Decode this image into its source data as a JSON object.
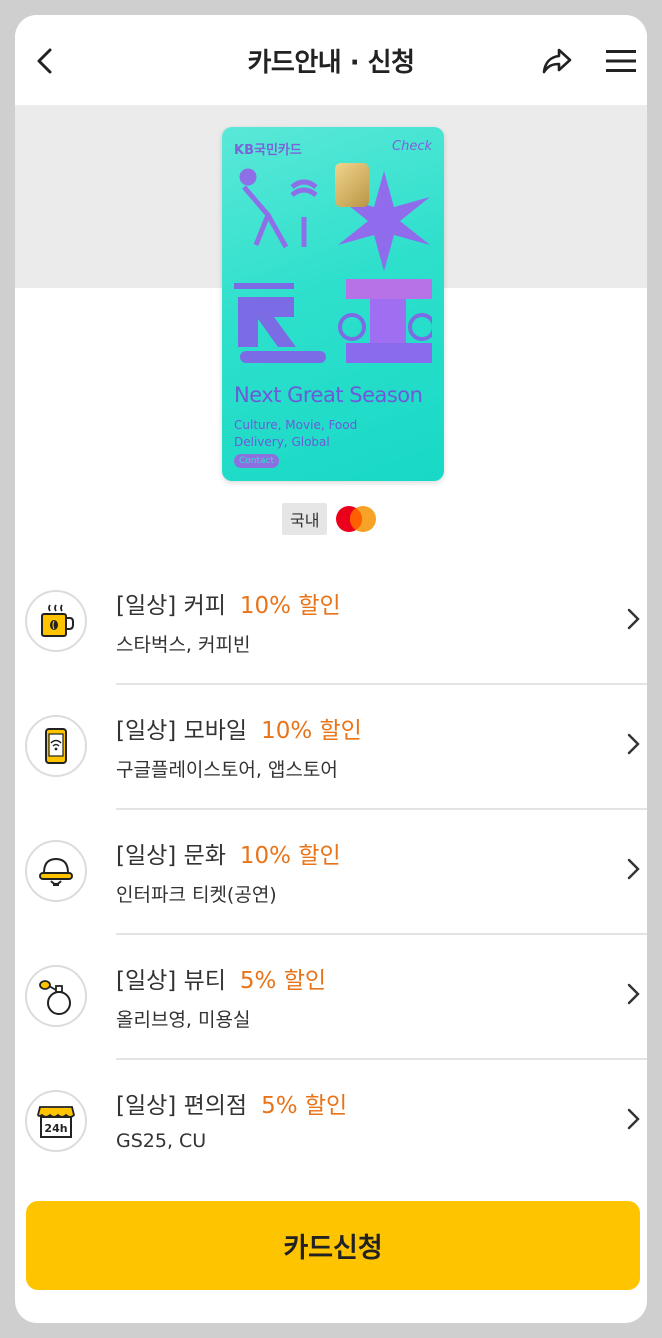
{
  "header": {
    "title": "카드안내 · 신청",
    "back_icon": "chevron-left-icon",
    "share_icon": "share-icon",
    "menu_icon": "hamburger-menu-icon"
  },
  "card": {
    "brand": "KB국민카드",
    "type": "Check",
    "slogan": "Next Great Season",
    "desc_line1": "Culture, Movie, Food",
    "desc_line2": "Delivery, Global",
    "tag": "Contact"
  },
  "badges": {
    "domestic": "국내",
    "network_icon": "mastercard-logo"
  },
  "benefits": [
    {
      "category": "[일상] 커피",
      "discount": "10% 할인",
      "detail": "스타벅스, 커피빈",
      "icon": "coffee-cup-icon"
    },
    {
      "category": "[일상] 모바일",
      "discount": "10% 할인",
      "detail": "구글플레이스토어, 앱스토어",
      "icon": "smartphone-icon"
    },
    {
      "category": "[일상] 문화",
      "discount": "10% 할인",
      "detail": "인터파크 티켓(공연)",
      "icon": "theater-icon"
    },
    {
      "category": "[일상] 뷰티",
      "discount": "5% 할인",
      "detail": "올리브영, 미용실",
      "icon": "perfume-icon"
    },
    {
      "category": "[일상] 편의점",
      "discount": "5% 할인",
      "detail": "GS25, CU",
      "icon": "store-24h-icon"
    }
  ],
  "apply_button": "카드신청",
  "colors": {
    "accent": "#ffc400",
    "discount": "#e8741a",
    "card_mint": "#2ee0cc",
    "card_purple": "#7c63d9"
  }
}
